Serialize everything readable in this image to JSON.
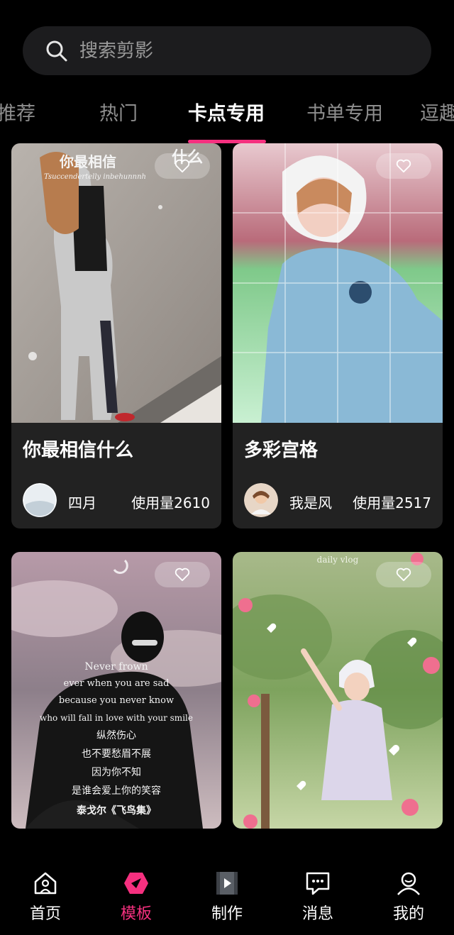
{
  "search": {
    "placeholder": "搜索剪影",
    "icon": "search-icon"
  },
  "tabs": [
    {
      "label": "推荐",
      "active": false
    },
    {
      "label": "热门",
      "active": false
    },
    {
      "label": "卡点专用",
      "active": true
    },
    {
      "label": "书单专用",
      "active": false
    },
    {
      "label": "逗趣",
      "active": false
    }
  ],
  "colors": {
    "accent": "#f5307f",
    "card_bg": "#222222",
    "search_bg": "#1c1c1e"
  },
  "cards": [
    {
      "title": "你最相信什么",
      "author": "四月",
      "usage": "使用量2610",
      "overlay_text": "你最相信",
      "overlay_text_right": "什么",
      "overlay_sub": "Tsuccendertelly inbehunnnh"
    },
    {
      "title": "多彩宫格",
      "author": "我是风",
      "usage": "使用量2517"
    },
    {
      "overlay_lines": [
        "Never frown",
        "ever when you are sad",
        "because you never know",
        "who will fall in love with your smile",
        "纵然伤心",
        "也不要愁眉不展",
        "因为你不知",
        "是谁会爱上你的笑容",
        "泰戈尔《飞鸟集》"
      ]
    },
    {
      "overlay_lines": [
        "daily vlog"
      ]
    }
  ],
  "nav": [
    {
      "label": "首页",
      "icon": "home-icon",
      "active": false
    },
    {
      "label": "模板",
      "icon": "template-icon",
      "active": true
    },
    {
      "label": "制作",
      "icon": "video-create-icon",
      "active": false
    },
    {
      "label": "消息",
      "icon": "message-icon",
      "active": false
    },
    {
      "label": "我的",
      "icon": "profile-icon",
      "active": false
    }
  ]
}
